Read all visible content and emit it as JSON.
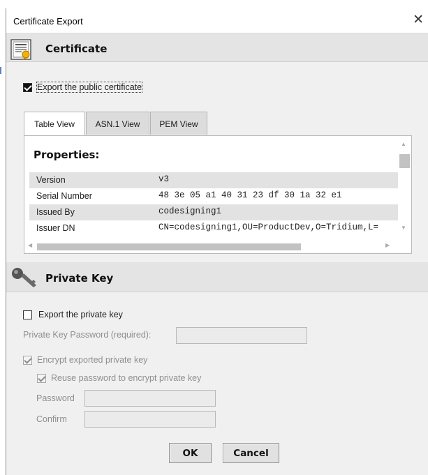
{
  "window": {
    "title": "Certificate Export",
    "close_glyph": "✕"
  },
  "certificate_section": {
    "title": "Certificate",
    "icon": "certificate-icon",
    "export_public": {
      "label": "Export the public certificate",
      "checked": true
    },
    "tabs": [
      {
        "label": "Table View",
        "active": true
      },
      {
        "label": "ASN.1 View",
        "active": false
      },
      {
        "label": "PEM View",
        "active": false
      }
    ],
    "properties_title": "Properties:",
    "properties": [
      {
        "key": "Version",
        "value": "v3"
      },
      {
        "key": "Serial Number",
        "value": "48 3e 05 a1 40 31 23 df 30 1a 32 e1"
      },
      {
        "key": "Issued By",
        "value": "codesigning1"
      },
      {
        "key": "Issuer DN",
        "value": "CN=codesigning1,OU=ProductDev,O=Tridium,L="
      }
    ]
  },
  "private_key_section": {
    "title": "Private Key",
    "icon": "key-icon",
    "export_private": {
      "label": "Export the private key",
      "checked": false
    },
    "password_required_label": "Private Key Password (required):",
    "encrypt": {
      "label": "Encrypt exported private key",
      "checked": true
    },
    "reuse": {
      "label": "Reuse password to encrypt private key",
      "checked": true
    },
    "password_label": "Password",
    "confirm_label": "Confirm"
  },
  "buttons": {
    "ok": "OK",
    "cancel": "Cancel"
  }
}
